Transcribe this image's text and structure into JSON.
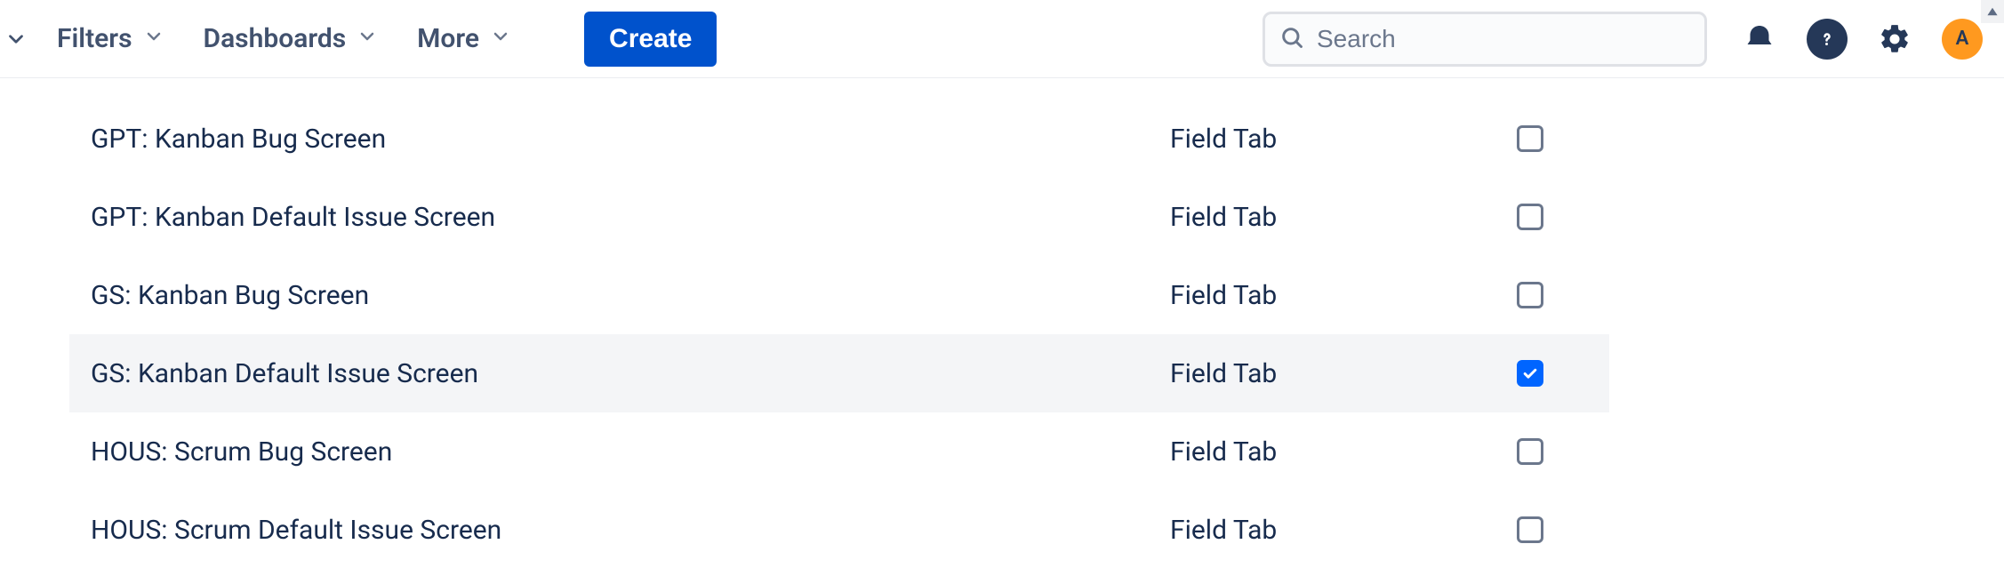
{
  "nav": {
    "filters": "Filters",
    "dashboards": "Dashboards",
    "more": "More",
    "create": "Create"
  },
  "search": {
    "placeholder": "Search",
    "value": ""
  },
  "avatar": {
    "initial": "A"
  },
  "screens": {
    "tab_label": "Field Tab",
    "rows": [
      {
        "name": "GPT: Kanban Bug Screen",
        "tab": "Field Tab",
        "checked": false,
        "selected": false
      },
      {
        "name": "GPT: Kanban Default Issue Screen",
        "tab": "Field Tab",
        "checked": false,
        "selected": false
      },
      {
        "name": "GS: Kanban Bug Screen",
        "tab": "Field Tab",
        "checked": false,
        "selected": false
      },
      {
        "name": "GS: Kanban Default Issue Screen",
        "tab": "Field Tab",
        "checked": true,
        "selected": true
      },
      {
        "name": "HOUS: Scrum Bug Screen",
        "tab": "Field Tab",
        "checked": false,
        "selected": false
      },
      {
        "name": "HOUS: Scrum Default Issue Screen",
        "tab": "Field Tab",
        "checked": false,
        "selected": false
      }
    ]
  }
}
